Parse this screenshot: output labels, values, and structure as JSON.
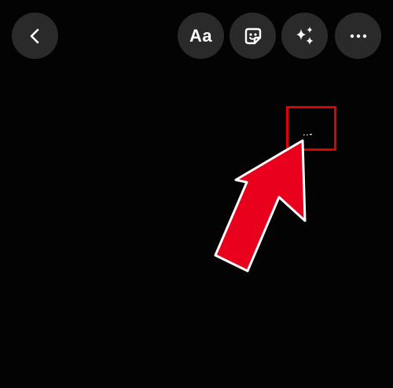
{
  "toolbar": {
    "text_tool_label": "Aa",
    "icons": {
      "back": "chevron-left-icon",
      "sticker": "sticker-icon",
      "effects": "sparkles-icon",
      "more": "more-horizontal-icon"
    }
  },
  "annotation": {
    "highlight_color": "#e00000",
    "arrow_color": "#e8001c",
    "arrow_outline": "#ffffff"
  }
}
